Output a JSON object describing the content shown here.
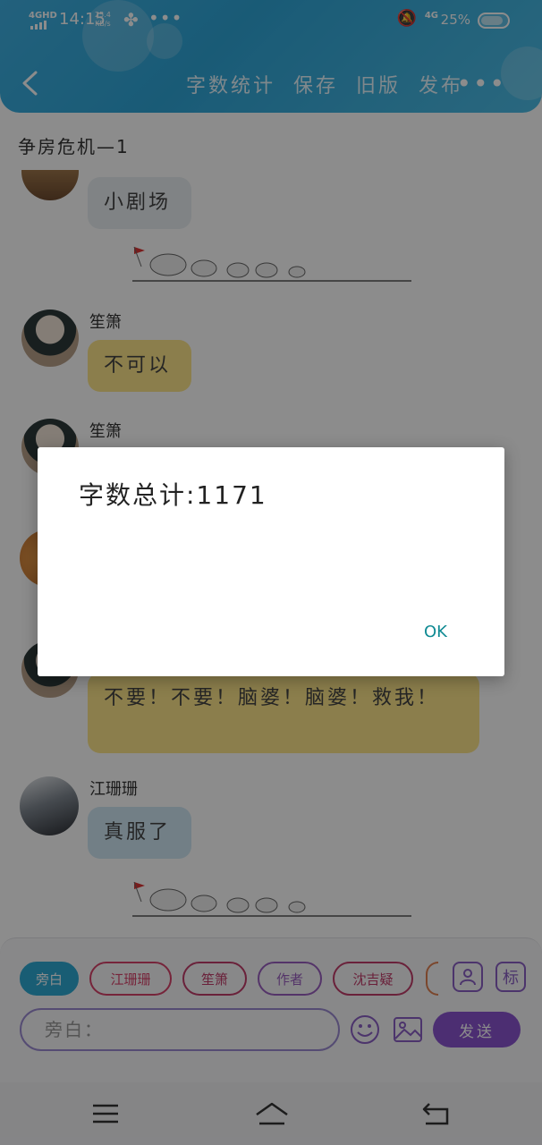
{
  "status_bar": {
    "network_label": "4GHD",
    "time": "14:15",
    "speed_value": "25.4",
    "speed_unit": "KB/s",
    "net_type": "4G",
    "battery": "25%"
  },
  "header": {
    "actions": [
      "字数统计",
      "保存",
      "旧版",
      "发布"
    ]
  },
  "story_title": "争房危机—1",
  "messages": [
    {
      "type": "bubble",
      "text": "小剧场",
      "style": "grey"
    },
    {
      "type": "divider"
    },
    {
      "type": "bubble",
      "speaker": "笙箫",
      "text": "不可以",
      "style": "yellow"
    },
    {
      "type": "bubble",
      "speaker": "笙箫",
      "text": "",
      "style": "yellow"
    },
    {
      "type": "bubble",
      "text": "不要！不要！脑婆！脑婆！救我！",
      "style": "yellow"
    },
    {
      "type": "bubble",
      "speaker": "江珊珊",
      "text": "真服了",
      "style": "blue"
    },
    {
      "type": "divider"
    }
  ],
  "input_area": {
    "roles": [
      "旁白",
      "江珊珊",
      "笙箫",
      "作者",
      "沈吉疑"
    ],
    "biao_label": "标",
    "input_placeholder": "旁白：",
    "send_label": "发送"
  },
  "dialog": {
    "message": "字数总计:1171",
    "ok_label": "OK"
  },
  "colors": {
    "header": "#2fa6d8",
    "send": "#8a55cf",
    "dialog_ok": "#0f8a93"
  }
}
